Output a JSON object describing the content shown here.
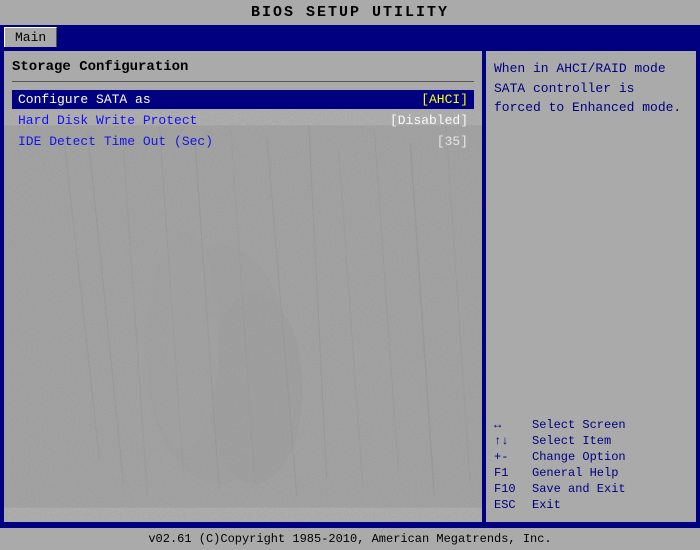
{
  "title": "BIOS SETUP UTILITY",
  "tabs": [
    {
      "label": "Main"
    }
  ],
  "left_panel": {
    "section_title": "Storage Configuration",
    "items": [
      {
        "label": "Configure SATA as",
        "value": "[AHCI]",
        "highlighted": true
      },
      {
        "label": "Hard Disk Write Protect",
        "value": "[Disabled]",
        "highlighted": false
      },
      {
        "label": "IDE Detect Time Out (Sec)",
        "value": "[35]",
        "highlighted": false
      }
    ]
  },
  "right_panel": {
    "help_text": "When in AHCI/RAID mode SATA controller is forced to Enhanced mode.",
    "keybinds": [
      {
        "key": "↔",
        "desc": "Select Screen"
      },
      {
        "key": "↑↓",
        "desc": "Select Item"
      },
      {
        "key": "+-",
        "desc": "Change Option"
      },
      {
        "key": "F1",
        "desc": "General Help"
      },
      {
        "key": "F10",
        "desc": "Save and Exit"
      },
      {
        "key": "ESC",
        "desc": "Exit"
      }
    ]
  },
  "footer": {
    "text": "v02.61 (C)Copyright 1985-2010, American Megatrends, Inc."
  }
}
